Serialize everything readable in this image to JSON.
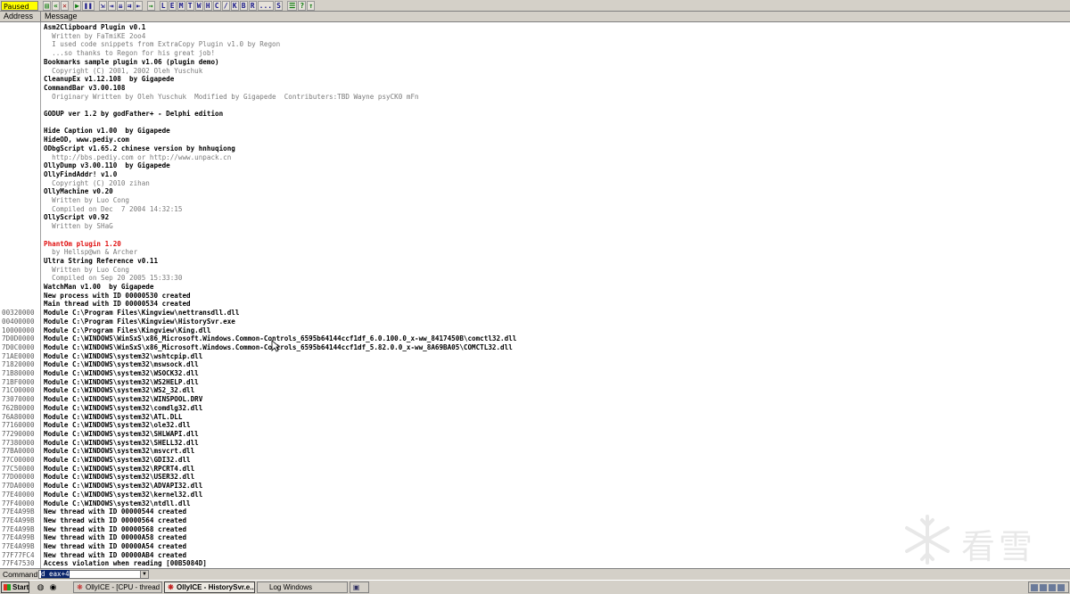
{
  "toolbar": {
    "status": "Paused",
    "buttons": [
      {
        "label": "▤",
        "name": "open-icon",
        "style": "g"
      },
      {
        "label": "«",
        "name": "restart-icon",
        "style": "g"
      },
      {
        "label": "✕",
        "name": "close-icon",
        "style": "r"
      },
      {
        "label": "▶",
        "name": "run-icon",
        "style": "g",
        "sep": true
      },
      {
        "label": "❚❚",
        "name": "pause-icon",
        "style": ""
      },
      {
        "label": "⇲",
        "name": "step-into-icon",
        "style": "",
        "sep": true
      },
      {
        "label": "⇥",
        "name": "step-over-icon",
        "style": ""
      },
      {
        "label": "⇊",
        "name": "trace-into-icon",
        "style": ""
      },
      {
        "label": "⇉",
        "name": "trace-over-icon",
        "style": ""
      },
      {
        "label": "⇤",
        "name": "execute-till-return-icon",
        "style": ""
      },
      {
        "label": "→",
        "name": "go-to-icon",
        "style": "g",
        "sep": true
      },
      {
        "label": "L",
        "name": "log-window-button",
        "style": "",
        "sep": true
      },
      {
        "label": "E",
        "name": "executables-button",
        "style": ""
      },
      {
        "label": "M",
        "name": "memory-map-button",
        "style": ""
      },
      {
        "label": "T",
        "name": "threads-button",
        "style": ""
      },
      {
        "label": "W",
        "name": "windows-button",
        "style": ""
      },
      {
        "label": "H",
        "name": "handles-button",
        "style": ""
      },
      {
        "label": "C",
        "name": "cpu-button",
        "style": ""
      },
      {
        "label": "/",
        "name": "patches-button",
        "style": ""
      },
      {
        "label": "K",
        "name": "call-stack-button",
        "style": ""
      },
      {
        "label": "B",
        "name": "breakpoints-button",
        "style": ""
      },
      {
        "label": "R",
        "name": "references-button",
        "style": ""
      },
      {
        "label": "...",
        "name": "run-trace-button",
        "style": ""
      },
      {
        "label": "S",
        "name": "source-button",
        "style": ""
      },
      {
        "label": "☰",
        "name": "options-icon",
        "style": "g",
        "sep": true
      },
      {
        "label": "?",
        "name": "help-icon",
        "style": "g"
      },
      {
        "label": "↑",
        "name": "appearance-icon",
        "style": "g"
      }
    ]
  },
  "columns": {
    "address": "Address",
    "message": "Message"
  },
  "rows": [
    {
      "a": "",
      "m": "Asm2Clipboard Plugin v0.1",
      "s": "bold"
    },
    {
      "a": "",
      "m": "  Written by FaTmiKE 2oo4",
      "s": "gray"
    },
    {
      "a": "",
      "m": "  I used code snippets from ExtraCopy Plugin v1.0 by Regon",
      "s": "gray"
    },
    {
      "a": "",
      "m": "  ...so thanks to Regon for his great job!",
      "s": "gray"
    },
    {
      "a": "",
      "m": "Bookmarks sample plugin v1.06 (plugin demo)",
      "s": "bold"
    },
    {
      "a": "",
      "m": "  Copyright (C) 2001, 2002 Oleh Yuschuk",
      "s": "gray"
    },
    {
      "a": "",
      "m": "CleanupEx v1.12.108  by Gigapede",
      "s": "bold"
    },
    {
      "a": "",
      "m": "CommandBar v3.00.108",
      "s": "bold"
    },
    {
      "a": "",
      "m": "  Originary Written by Oleh Yuschuk  Modified by Gigapede  Contributers:TBD Wayne psyCK0 mFn",
      "s": "gray"
    },
    {
      "a": "",
      "m": "",
      "s": "bold"
    },
    {
      "a": "",
      "m": "GODUP ver 1.2 by godFather+ - Delphi edition",
      "s": "bold"
    },
    {
      "a": "",
      "m": "",
      "s": "bold"
    },
    {
      "a": "",
      "m": "Hide Caption v1.00  by Gigapede",
      "s": "bold"
    },
    {
      "a": "",
      "m": "HideOD, www.pediy.com",
      "s": "bold"
    },
    {
      "a": "",
      "m": "ODbgScript v1.65.2 chinese version by hnhuqiong",
      "s": "bold"
    },
    {
      "a": "",
      "m": "  http://bbs.pediy.com or http://www.unpack.cn",
      "s": "gray"
    },
    {
      "a": "",
      "m": "OllyDump v3.00.110  by Gigapede",
      "s": "bold"
    },
    {
      "a": "",
      "m": "OllyFindAddr! v1.0",
      "s": "bold"
    },
    {
      "a": "",
      "m": "  Copyright (C) 2010 zihan",
      "s": "gray"
    },
    {
      "a": "",
      "m": "OllyMachine v0.20",
      "s": "bold"
    },
    {
      "a": "",
      "m": "  Written by Luo Cong",
      "s": "gray"
    },
    {
      "a": "",
      "m": "  Compiled on Dec  7 2004 14:32:15",
      "s": "gray"
    },
    {
      "a": "",
      "m": "OllyScript v0.92",
      "s": "bold"
    },
    {
      "a": "",
      "m": "  Written by SHaG",
      "s": "gray"
    },
    {
      "a": "",
      "m": "",
      "s": "bold"
    },
    {
      "a": "",
      "m": "PhantOm plugin 1.20",
      "s": "red"
    },
    {
      "a": "",
      "m": "  by Hellsp@wn & Archer",
      "s": "gray"
    },
    {
      "a": "",
      "m": "Ultra String Reference v0.11",
      "s": "bold"
    },
    {
      "a": "",
      "m": "  Written by Luo Cong",
      "s": "gray"
    },
    {
      "a": "",
      "m": "  Compiled on Sep 20 2005 15:33:30",
      "s": "gray"
    },
    {
      "a": "",
      "m": "WatchMan v1.00  by Gigapede",
      "s": "bold"
    },
    {
      "a": "",
      "m": "New process with ID 00000530 created",
      "s": "bold"
    },
    {
      "a": "",
      "m": "Main thread with ID 00000534 created",
      "s": "bold"
    },
    {
      "a": "00320000",
      "m": "Module C:\\Program Files\\Kingview\\nettransdll.dll",
      "s": "bold"
    },
    {
      "a": "00400000",
      "m": "Module C:\\Program Files\\Kingview\\HistorySvr.exe",
      "s": "bold"
    },
    {
      "a": "10000000",
      "m": "Module C:\\Program Files\\Kingview\\King.dll",
      "s": "bold"
    },
    {
      "a": "7D0D0000",
      "m": "Module C:\\WINDOWS\\WinSxS\\x86_Microsoft.Windows.Common-Controls_6595b64144ccf1df_6.0.100.0_x-ww_8417450B\\comctl32.dll",
      "s": "bold"
    },
    {
      "a": "7D0C0000",
      "m": "Module C:\\WINDOWS\\WinSxS\\x86_Microsoft.Windows.Common-Controls_6595b64144ccf1df_5.82.0.0_x-ww_8A69BA05\\COMCTL32.dll",
      "s": "bold"
    },
    {
      "a": "71AE0000",
      "m": "Module C:\\WINDOWS\\system32\\wshtcpip.dll",
      "s": "bold"
    },
    {
      "a": "71820000",
      "m": "Module C:\\WINDOWS\\system32\\mswsock.dll",
      "s": "bold"
    },
    {
      "a": "71B80000",
      "m": "Module C:\\WINDOWS\\system32\\WSOCK32.dll",
      "s": "bold"
    },
    {
      "a": "71BF0000",
      "m": "Module C:\\WINDOWS\\system32\\WS2HELP.dll",
      "s": "bold"
    },
    {
      "a": "71C00000",
      "m": "Module C:\\WINDOWS\\system32\\WS2_32.dll",
      "s": "bold"
    },
    {
      "a": "73070000",
      "m": "Module C:\\WINDOWS\\system32\\WINSPOOL.DRV",
      "s": "bold"
    },
    {
      "a": "762B0000",
      "m": "Module C:\\WINDOWS\\system32\\comdlg32.dll",
      "s": "bold"
    },
    {
      "a": "76A80000",
      "m": "Module C:\\WINDOWS\\system32\\ATL.DLL",
      "s": "bold"
    },
    {
      "a": "77160000",
      "m": "Module C:\\WINDOWS\\system32\\ole32.dll",
      "s": "bold"
    },
    {
      "a": "77290000",
      "m": "Module C:\\WINDOWS\\system32\\SHLWAPI.dll",
      "s": "bold"
    },
    {
      "a": "77380000",
      "m": "Module C:\\WINDOWS\\system32\\SHELL32.dll",
      "s": "bold"
    },
    {
      "a": "77BA0000",
      "m": "Module C:\\WINDOWS\\system32\\msvcrt.dll",
      "s": "bold"
    },
    {
      "a": "77C00000",
      "m": "Module C:\\WINDOWS\\system32\\GDI32.dll",
      "s": "bold"
    },
    {
      "a": "77C50000",
      "m": "Module C:\\WINDOWS\\system32\\RPCRT4.dll",
      "s": "bold"
    },
    {
      "a": "77D00000",
      "m": "Module C:\\WINDOWS\\system32\\USER32.dll",
      "s": "bold"
    },
    {
      "a": "77DA0000",
      "m": "Module C:\\WINDOWS\\system32\\ADVAPI32.dll",
      "s": "bold"
    },
    {
      "a": "77E40000",
      "m": "Module C:\\WINDOWS\\system32\\kernel32.dll",
      "s": "bold"
    },
    {
      "a": "77F40000",
      "m": "Module C:\\WINDOWS\\system32\\ntdll.dll",
      "s": "bold"
    },
    {
      "a": "77E4A99B",
      "m": "New thread with ID 00000544 created",
      "s": "bold"
    },
    {
      "a": "77E4A99B",
      "m": "New thread with ID 00000564 created",
      "s": "bold"
    },
    {
      "a": "77E4A99B",
      "m": "New thread with ID 00000568 created",
      "s": "bold"
    },
    {
      "a": "77E4A99B",
      "m": "New thread with ID 00000A58 created",
      "s": "bold"
    },
    {
      "a": "77E4A99B",
      "m": "New thread with ID 00000A54 created",
      "s": "bold"
    },
    {
      "a": "77F77FC4",
      "m": "New thread with ID 00000AB4 created",
      "s": "bold"
    },
    {
      "a": "77F47530",
      "m": "Access violation when reading [00B5084D]",
      "s": "bold"
    }
  ],
  "command": {
    "label": "Command",
    "value": "d eax+4"
  },
  "taskbar": {
    "start": "Start",
    "quicklaunch": [
      {
        "icon": "◍",
        "name": "desktop-quicklaunch-icon"
      },
      {
        "icon": "◉",
        "name": "browser-quicklaunch-icon"
      }
    ],
    "tasks": [
      {
        "label": "OllyICE - [CPU - thread 0...",
        "icon": "❋",
        "name": "task-ollyice-cpu",
        "active": false
      },
      {
        "label": "OllyICE - HistorySvr.e...",
        "icon": "❋",
        "name": "task-ollyice-historysvr",
        "active": true
      },
      {
        "label": "Log Windows",
        "icon": "",
        "name": "task-log-windows",
        "active": false
      },
      {
        "label": "",
        "icon": "▣",
        "name": "task-icon-only",
        "active": false
      }
    ]
  },
  "watermark": {
    "text": "看雪"
  },
  "colors": {
    "toolbar_bg": "#d4d0c8",
    "status_yellow": "#ffff00",
    "red_entry": "#e01010",
    "gray_entry": "#7a7a7a"
  }
}
